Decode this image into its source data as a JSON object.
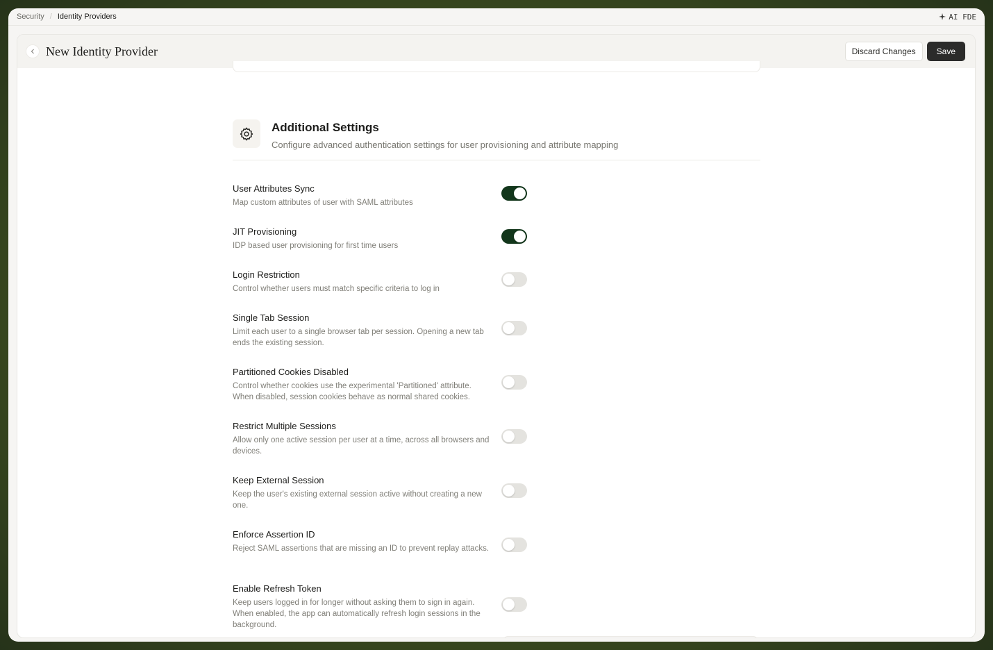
{
  "breadcrumb": {
    "items": [
      "Security",
      "Identity Providers"
    ]
  },
  "ai_badge": {
    "icon": "sparkle-icon",
    "label": "AI FDE"
  },
  "header": {
    "title": "New Identity Provider",
    "discard_label": "Discard Changes",
    "save_label": "Save"
  },
  "section": {
    "icon": "gear-icon",
    "title": "Additional Settings",
    "subtitle": "Configure advanced authentication settings for user provisioning and attribute mapping"
  },
  "settings": [
    {
      "title": "User Attributes Sync",
      "desc": "Map custom attributes of user with SAML attributes",
      "enabled": true
    },
    {
      "title": "JIT Provisioning",
      "desc": "IDP based user provisioning for first time users",
      "enabled": true
    },
    {
      "title": "Login Restriction",
      "desc": "Control whether users must match specific criteria to log in",
      "enabled": false
    },
    {
      "title": "Single Tab Session",
      "desc": "Limit each user to a single browser tab per session. Opening a new tab ends the existing session.",
      "enabled": false
    },
    {
      "title": "Partitioned Cookies Disabled",
      "desc": "Control whether cookies use the experimental 'Partitioned' attribute. When disabled, session cookies behave as normal shared cookies.",
      "enabled": false
    },
    {
      "title": "Restrict Multiple Sessions",
      "desc": "Allow only one active session per user at a time, across all browsers and devices.",
      "enabled": false
    },
    {
      "title": "Keep External Session",
      "desc": "Keep the user's existing external session active without creating a new one.",
      "enabled": false
    },
    {
      "title": "Enforce Assertion ID",
      "desc": "Reject SAML assertions that are missing an ID to prevent replay attacks.",
      "enabled": false
    },
    {
      "title": "Enable Refresh Token",
      "desc": "Keep users logged in for longer without asking them to sign in again. When enabled, the app can automatically refresh login sessions in the background.",
      "enabled": false
    }
  ],
  "colors": {
    "toggle_on": "#12361b",
    "toggle_off": "#e4e3df",
    "save_bg": "#2b2b2a"
  }
}
